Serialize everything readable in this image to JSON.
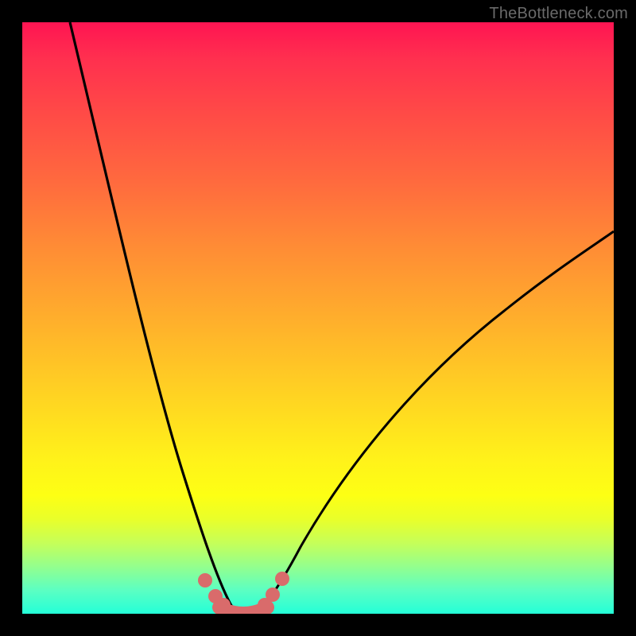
{
  "watermark": "TheBottleneck.com",
  "chart_data": {
    "type": "line",
    "title": "",
    "xlabel": "",
    "ylabel": "",
    "xlim": [
      0,
      100
    ],
    "ylim": [
      0,
      100
    ],
    "series": [
      {
        "name": "left-curve",
        "x": [
          8,
          12,
          16,
          20,
          24,
          27,
          29,
          31,
          33,
          34.5,
          36
        ],
        "values": [
          100,
          78,
          56,
          36,
          20,
          9,
          4.5,
          2,
          1,
          0.6,
          0.5
        ]
      },
      {
        "name": "right-curve",
        "x": [
          38,
          40,
          42,
          45,
          50,
          56,
          64,
          74,
          86,
          100
        ],
        "values": [
          0.5,
          0.7,
          1.2,
          2.5,
          6,
          12,
          22,
          35,
          48,
          61
        ]
      },
      {
        "name": "markers-left",
        "x": [
          30.5,
          32.5,
          33.8
        ],
        "values": [
          3.5,
          1.8,
          1.0
        ]
      },
      {
        "name": "markers-right",
        "x": [
          40.5,
          42,
          44
        ],
        "values": [
          1.2,
          2.0,
          3.5
        ]
      },
      {
        "name": "bottom-band",
        "x": [
          34,
          35,
          36,
          37,
          38,
          39,
          40
        ],
        "values": [
          0.6,
          0.5,
          0.5,
          0.5,
          0.5,
          0.6,
          0.7
        ]
      }
    ],
    "colors": {
      "curve": "#000000",
      "marker": "#d96b6b",
      "gradient_top": "#ff1452",
      "gradient_bottom": "#24ffd8"
    }
  }
}
